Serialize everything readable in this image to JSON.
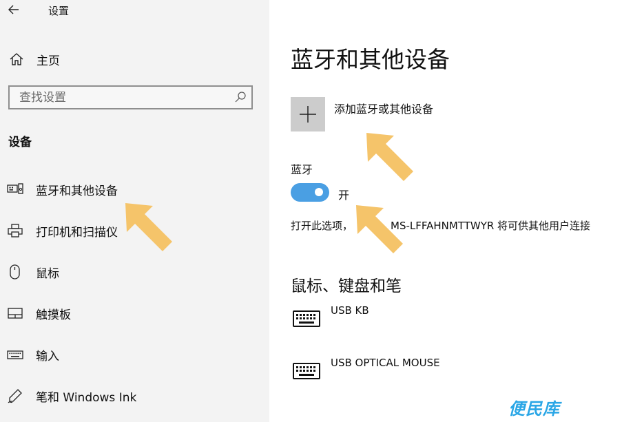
{
  "window": {
    "title": "设置"
  },
  "sidebar": {
    "home_label": "主页",
    "search": {
      "placeholder": "查找设置",
      "value": ""
    },
    "section_heading": "设备",
    "items": [
      {
        "label": "蓝牙和其他设备",
        "icon": "bluetooth-devices-icon"
      },
      {
        "label": "打印机和扫描仪",
        "icon": "printer-icon"
      },
      {
        "label": "鼠标",
        "icon": "mouse-icon"
      },
      {
        "label": "触摸板",
        "icon": "touchpad-icon"
      },
      {
        "label": "输入",
        "icon": "keyboard-icon"
      },
      {
        "label": "笔和 Windows Ink",
        "icon": "pen-icon"
      }
    ]
  },
  "main": {
    "title": "蓝牙和其他设备",
    "add_device_label": "添加蓝牙或其他设备",
    "bluetooth": {
      "heading": "蓝牙",
      "state_label": "开",
      "is_on": true,
      "discover_prefix": "打开此选项，",
      "discover_suffix": "MS-LFFAHNMTTWYR 将可供其他用户连接"
    },
    "group_heading": "鼠标、键盘和笔",
    "devices": [
      {
        "name": "USB KB",
        "icon": "keyboard-icon"
      },
      {
        "name": "USB OPTICAL MOUSE",
        "icon": "keyboard-icon"
      }
    ]
  },
  "overlay": {
    "watermark": "便民库",
    "arrow_color": "#f5c46a"
  },
  "colors": {
    "accent": "#4a9fe3",
    "sidebar_bg": "#f3f3f3",
    "tile_bg": "#cccccc"
  }
}
